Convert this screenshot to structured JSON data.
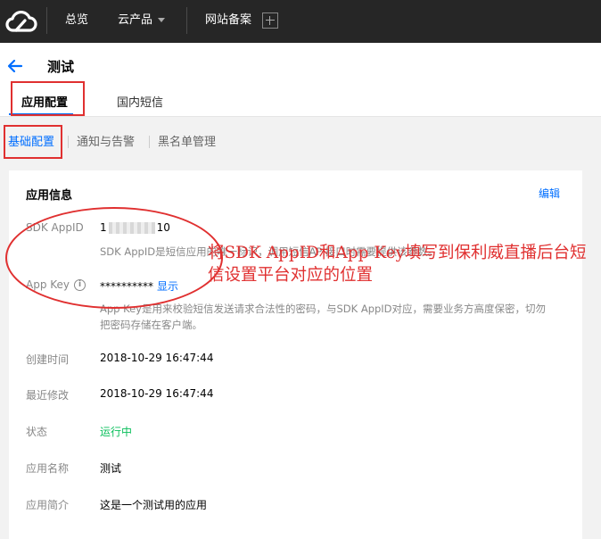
{
  "topbar": {
    "nav": [
      "总览",
      "云产品",
      "网站备案"
    ]
  },
  "header": {
    "title": "测试",
    "tabs": [
      "应用配置",
      "国内短信"
    ]
  },
  "subtabs": [
    "基础配置",
    "通知与告警",
    "黑名单管理"
  ],
  "card": {
    "title": "应用信息",
    "edit": "编辑",
    "sdk_appid": {
      "label": "SDK AppID",
      "value_prefix": "1",
      "value_suffix": "10",
      "hint": "SDK AppID是短信应用的唯一标识，调用短信API接口时需要提供该参数。"
    },
    "app_key": {
      "label": "App Key",
      "info_icon": "i",
      "value": "**********",
      "show_link": "显示",
      "hint_line1": "App Key是用来校验短信发送请求合法性的密码，与SDK AppID对应，需要业务方高度保密，切勿",
      "hint_line2": "把密码存储在客户端。"
    },
    "rows": [
      {
        "label": "创建时间",
        "value": "2018-10-29 16:47:44"
      },
      {
        "label": "最近修改",
        "value": "2018-10-29 16:47:44"
      },
      {
        "label": "状态",
        "value": "运行中"
      },
      {
        "label": "应用名称",
        "value": "测试"
      },
      {
        "label": "应用简介",
        "value": "这是一个测试用的应用"
      }
    ]
  },
  "annotation": {
    "note": "将SDK AppID和App Key填写到保利威直播后台短信设置平台对应的位置",
    "color": "#e03030"
  },
  "colors": {
    "topbar": "#262626",
    "accent": "#006eff",
    "status_running": "#0abf5b"
  }
}
